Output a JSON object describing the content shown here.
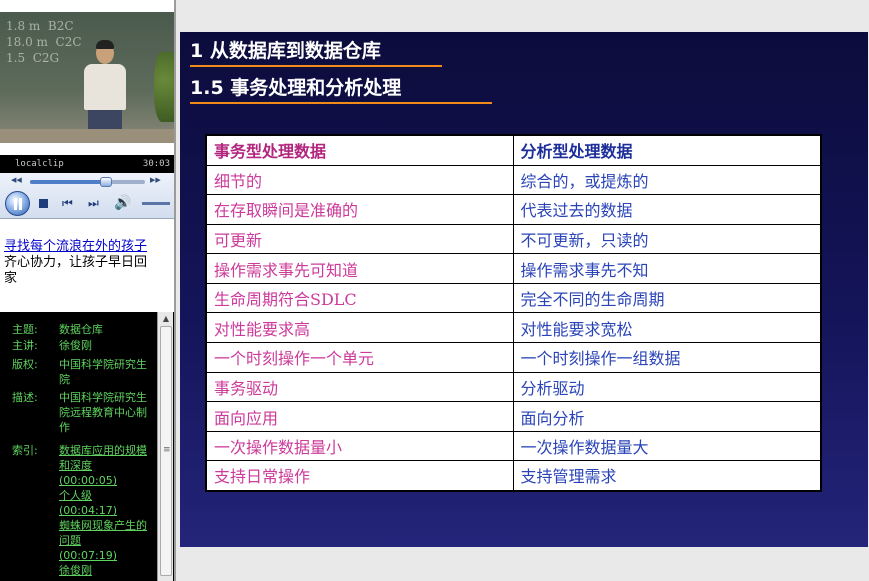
{
  "player": {
    "clip_name": "localclip",
    "clip_time": "30:03",
    "progress": 0.66,
    "board_writing": "1.8 m  B2C\n18.0 m  C2C\n1.5  C2G",
    "icons": {
      "seek_back": "rewind-icon",
      "seek_forward": "fast-forward-icon",
      "play_pause": "pause-icon",
      "stop": "stop-icon",
      "prev": "previous-track-icon",
      "next": "next-track-icon",
      "volume": "speaker-icon"
    }
  },
  "promo": {
    "link": "寻找每个流浪在外的孩子",
    "text": "齐心协力，让孩子早日回家"
  },
  "info": {
    "rows": [
      {
        "label": "主题:",
        "value": "数据仓库"
      },
      {
        "label": "主讲:",
        "value": "徐俊刚"
      },
      {
        "label": "版权:",
        "value": "中国科学院研究生院"
      },
      {
        "label": "描述:",
        "value": "中国科学院研究生院远程教育中心制作"
      }
    ],
    "index_label": "索引:",
    "index": [
      {
        "title": "数据库应用的规模和深度",
        "time": "(00:00:05)"
      },
      {
        "title": "个人级",
        "time": "(00:04:17)"
      },
      {
        "title": "蜘蛛网现象产生的问题",
        "time": "(00:07:19)"
      },
      {
        "title": "徐俊刚",
        "time": ""
      }
    ]
  },
  "slide": {
    "heading1": "1   从数据库到数据仓库",
    "heading2": "1.5  事务处理和分析处理",
    "table": {
      "headers": [
        "事务型处理数据",
        "分析型处理数据"
      ],
      "rows": [
        [
          "细节的",
          "综合的，或提炼的"
        ],
        [
          "在存取瞬间是准确的",
          "代表过去的数据"
        ],
        [
          "可更新",
          "不可更新，只读的"
        ],
        [
          "操作需求事先可知道",
          "操作需求事先不知"
        ],
        [
          "生命周期符合SDLC",
          "完全不同的生命周期"
        ],
        [
          "对性能要求高",
          "对性能要求宽松"
        ],
        [
          "一个时刻操作一个单元",
          "一个时刻操作一组数据"
        ],
        [
          "事务驱动",
          "分析驱动"
        ],
        [
          "面向应用",
          "面向分析"
        ],
        [
          "一次操作数据量小",
          "一次操作数据量大"
        ],
        [
          "支持日常操作",
          "支持管理需求"
        ]
      ]
    },
    "colors": {
      "background": "#14145a",
      "heading_underline": "#f08a18",
      "col1_text": "#cc3a9a",
      "col2_text": "#2a44b8"
    }
  }
}
